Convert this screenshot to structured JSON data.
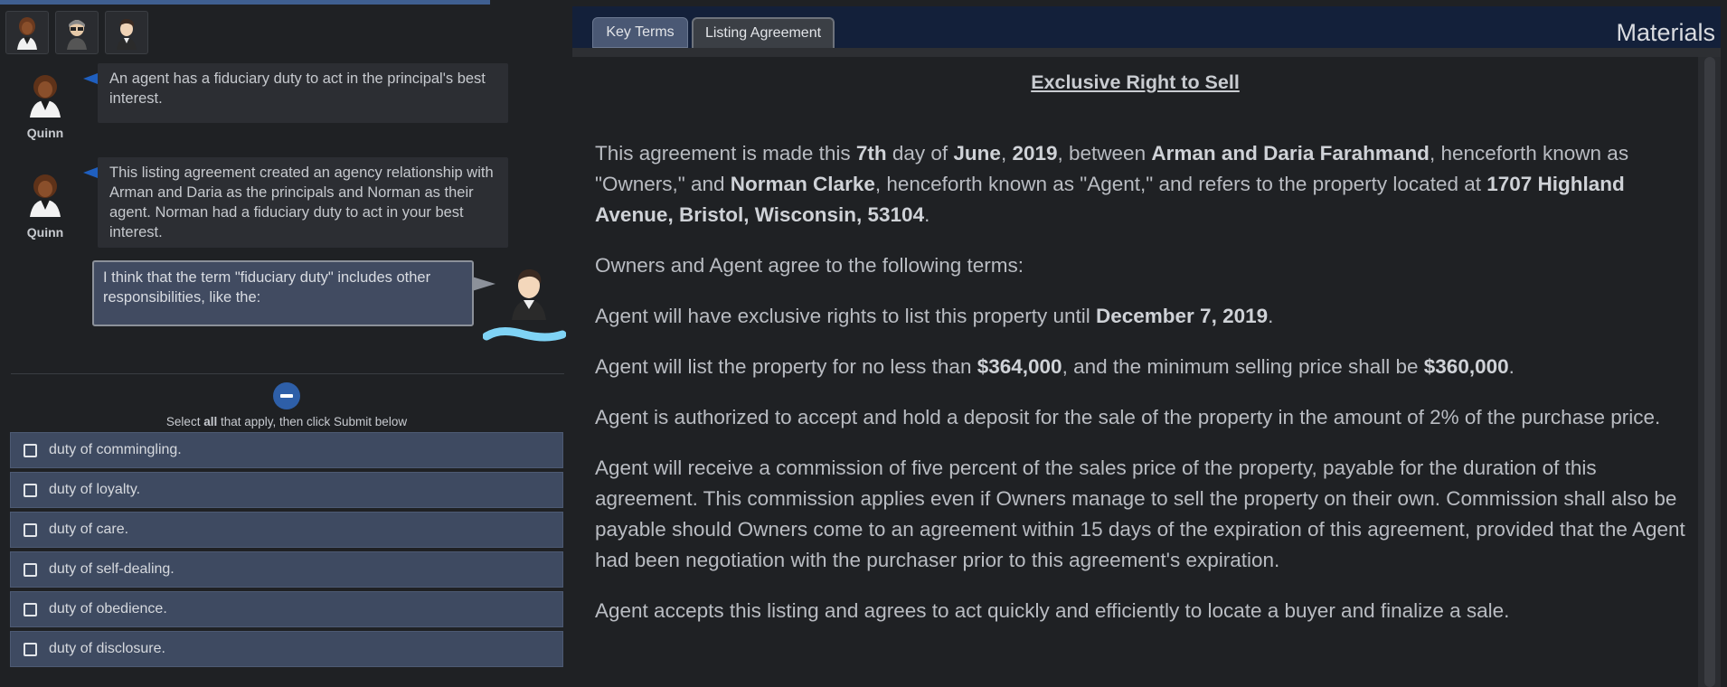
{
  "left_panel": {
    "progress_fraction": 0.86,
    "avatar_buttons": [
      "quinn-avatar",
      "norman-avatar",
      "user-avatar"
    ],
    "messages": [
      {
        "speaker": "Quinn",
        "text": "An agent has a fiduciary duty to act in the principal's best interest."
      },
      {
        "speaker": "Quinn",
        "text": "This listing agreement created an agency relationship with Arman and Daria as the principals and Norman as their agent. Norman had a fiduciary duty to act in your best interest."
      }
    ],
    "user_message": "I think that the term \"fiduciary duty\" includes other responsibilities, like the:",
    "instruction_pre": "Select ",
    "instruction_bold": "all",
    "instruction_post": " that apply, then click Submit below",
    "options": [
      "duty of commingling.",
      "duty of loyalty.",
      "duty of care.",
      "duty of self-dealing.",
      "duty of obedience.",
      "duty of disclosure."
    ]
  },
  "right_panel": {
    "tabs": [
      "Key Terms",
      "Listing Agreement"
    ],
    "active_tab": "Listing Agreement",
    "panel_title": "Materials",
    "document": {
      "title": "Exclusive Right to Sell",
      "p1": {
        "t1": "This agreement is made this ",
        "b1": "7th",
        "t2": " day of ",
        "b2": "June",
        "t3": ", ",
        "b3": "2019",
        "t4": ", between ",
        "b4": "Arman and Daria Farahmand",
        "t5": ", henceforth known as \"Owners,\" and ",
        "b5": "Norman Clarke",
        "t6": ", henceforth known as \"Agent,\" and refers to the property located at ",
        "b6": "1707 Highland Avenue, Bristol, Wisconsin, 53104",
        "t7": "."
      },
      "p2": "Owners and Agent agree to the following terms:",
      "p3": {
        "t1": "Agent will have exclusive rights to list this property until ",
        "b1": "December 7, 2019",
        "t2": "."
      },
      "p4": {
        "t1": "Agent will list the property for no less than ",
        "b1": "$364,000",
        "t2": ", and the minimum selling price shall be ",
        "b2": "$360,000",
        "t3": "."
      },
      "p5": "Agent is authorized to accept and hold a deposit for the sale of the property in the amount of 2% of the purchase price.",
      "p6": "Agent will receive a commission of five percent of the sales price of the property, payable for the duration of this agreement. This commission applies even if Owners manage to sell the property on their own. Commission shall also be payable should Owners come to an agreement within 15 days of the expiration of this agreement, provided that the Agent had been negotiation with the purchaser prior to this agreement's expiration.",
      "p7": "Agent accepts this listing and agrees to act quickly and efficiently to locate a buyer and finalize a sale."
    }
  },
  "colors": {
    "accent_blue": "#2e5fa8",
    "option_bg": "#3e4a61",
    "tab_bar": "#13203a"
  }
}
